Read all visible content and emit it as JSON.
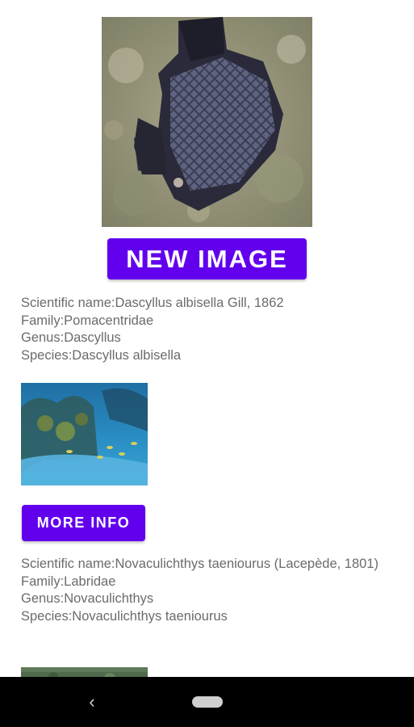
{
  "main_image": {
    "icon": "fish-photo-dascyllus"
  },
  "buttons": {
    "new_image": "NEW IMAGE",
    "more_info": "MORE INFO"
  },
  "results": [
    {
      "scientific_name": "Scientific name:Dascyllus albisella Gill, 1862",
      "family": "Family:Pomacentridae",
      "genus": "Genus:Dascyllus",
      "species": "Species:Dascyllus albisella",
      "thumbnail": "reef-photo-thumbnail"
    },
    {
      "scientific_name": "Scientific name:Novaculichthys taeniourus (Lacepède, 1801)",
      "family": "Family:Labridae",
      "genus": "Genus:Novaculichthys",
      "species": "Species:Novaculichthys taeniourus",
      "thumbnail": "reef-photo-thumbnail"
    }
  ],
  "nav": {
    "back_glyph": "‹"
  },
  "colors": {
    "accent": "#6200ee",
    "text": "#6b6b6b",
    "navbar": "#000000"
  }
}
